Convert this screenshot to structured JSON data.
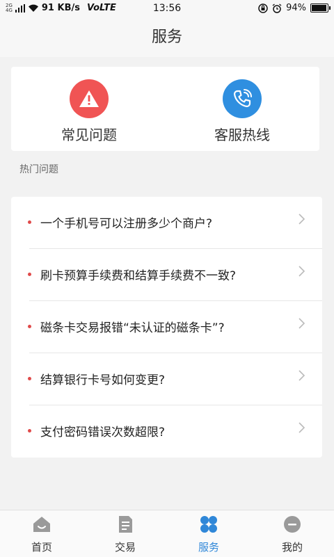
{
  "status_bar": {
    "network_top": "2G",
    "network_bottom": "4G",
    "speed": "91 KB/s",
    "volte": "VoLTE",
    "time": "13:56",
    "battery_percent_text": "94%",
    "battery_level": 0.94
  },
  "header": {
    "title": "服务"
  },
  "quick_actions": [
    {
      "label": "常见问题",
      "icon": "warning-icon",
      "color": "#f05454"
    },
    {
      "label": "客服热线",
      "icon": "phone-icon",
      "color": "#2f8fe0"
    }
  ],
  "hot_section": {
    "label": "热门问题"
  },
  "questions": [
    {
      "text": "一个手机号可以注册多少个商户?"
    },
    {
      "text": "刷卡预算手续费和结算手续费不一致?"
    },
    {
      "text": "磁条卡交易报错“未认证的磁条卡”?"
    },
    {
      "text": "结算银行卡号如何变更?"
    },
    {
      "text": "支付密码错误次数超限?"
    }
  ],
  "tabs": [
    {
      "label": "首页",
      "icon": "home-icon",
      "active": false
    },
    {
      "label": "交易",
      "icon": "document-icon",
      "active": false
    },
    {
      "label": "服务",
      "icon": "grid-icon",
      "active": true
    },
    {
      "label": "我的",
      "icon": "profile-icon",
      "active": false
    }
  ],
  "colors": {
    "accent": "#2f87d8",
    "bullet": "#e04a4a",
    "inactive_icon": "#9a9a9a"
  }
}
